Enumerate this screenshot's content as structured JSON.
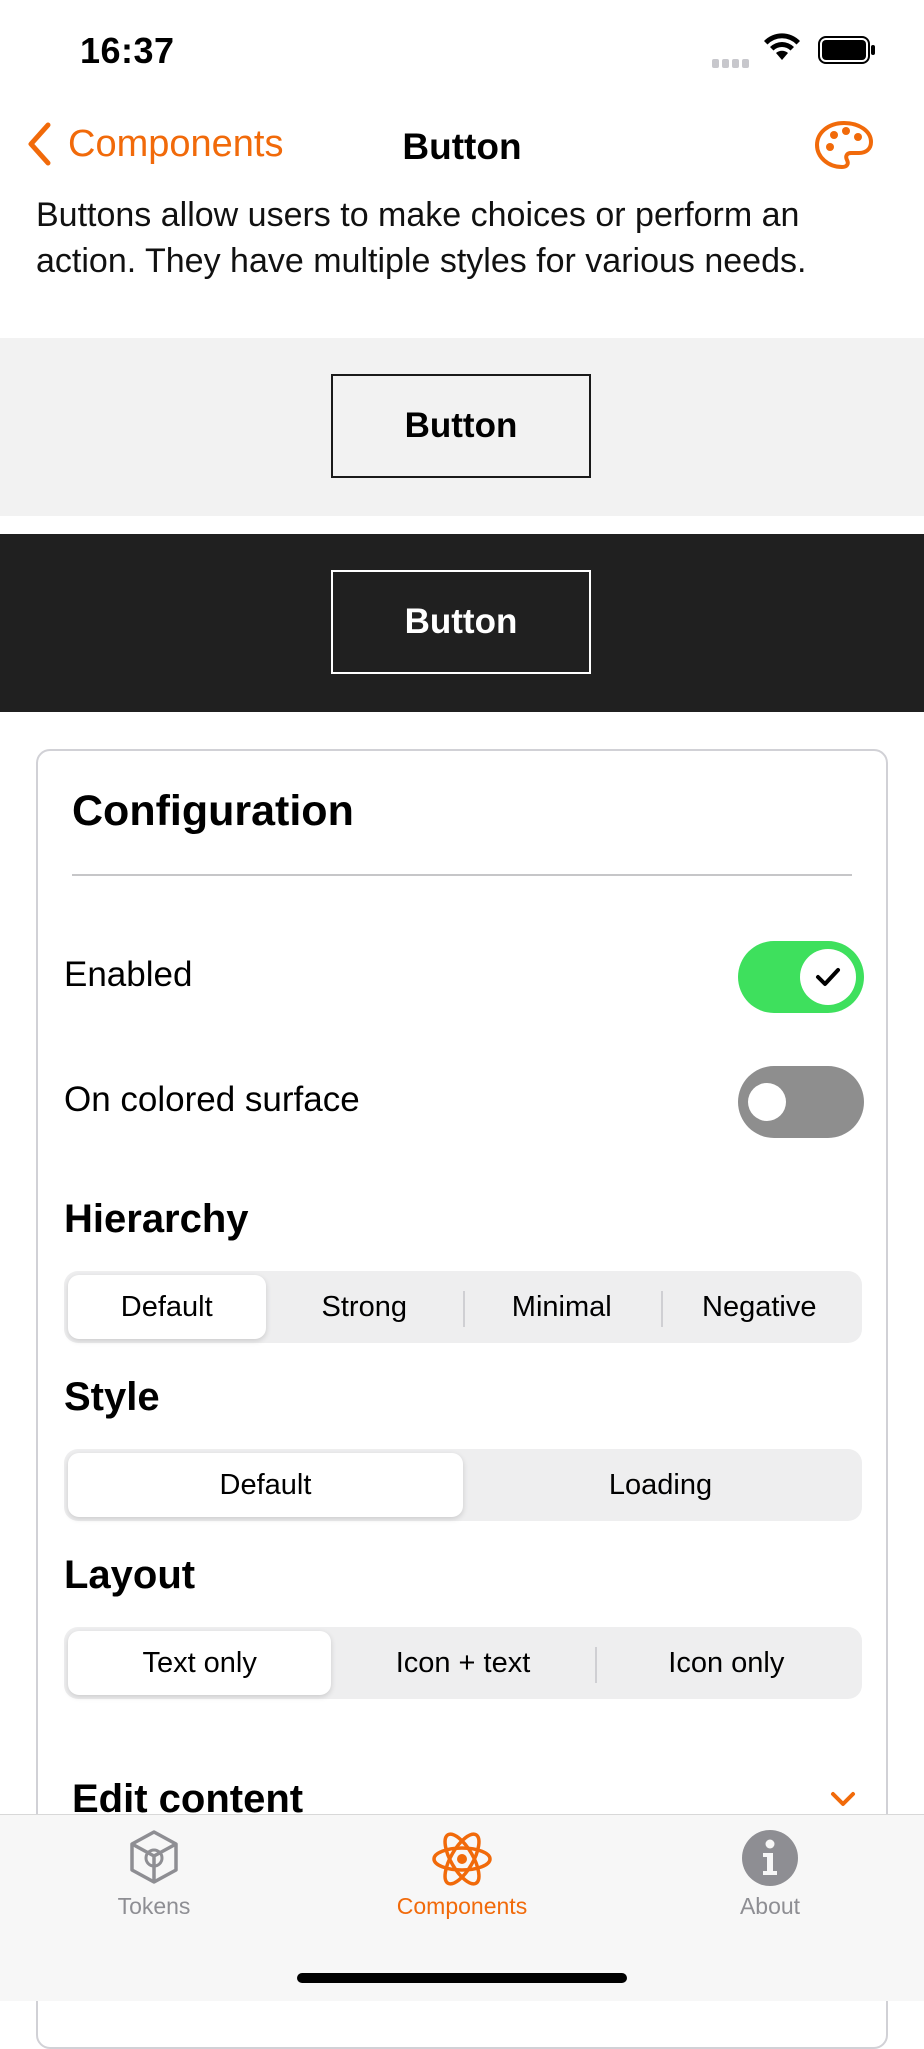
{
  "status_bar": {
    "time": "16:37"
  },
  "nav": {
    "back_label": "Components",
    "title": "Button"
  },
  "description": "Buttons allow users to make choices or perform an action. They have multiple styles for various needs.",
  "preview": {
    "light_button_label": "Button",
    "dark_button_label": "Button"
  },
  "configuration": {
    "title": "Configuration",
    "enabled": {
      "label": "Enabled",
      "value": true
    },
    "on_colored_surface": {
      "label": "On colored surface",
      "value": false
    },
    "hierarchy": {
      "heading": "Hierarchy",
      "options": [
        "Default",
        "Strong",
        "Minimal",
        "Negative"
      ],
      "selected": "Default"
    },
    "style": {
      "heading": "Style",
      "options": [
        "Default",
        "Loading"
      ],
      "selected": "Default"
    },
    "layout": {
      "heading": "Layout",
      "options": [
        "Text only",
        "Icon + text",
        "Icon only"
      ],
      "selected": "Text only"
    },
    "edit_content": {
      "label": "Edit content"
    }
  },
  "tab_bar": {
    "items": [
      {
        "label": "Tokens",
        "icon": "cube-icon",
        "active": false
      },
      {
        "label": "Components",
        "icon": "atom-icon",
        "active": true
      },
      {
        "label": "About",
        "icon": "info-icon",
        "active": false
      }
    ]
  },
  "colors": {
    "accent": "#f16a0a",
    "toggle_on": "#3ee05d",
    "toggle_off": "#8e8e8e",
    "dark_surface": "#202020",
    "light_surface": "#f2f2f2"
  }
}
